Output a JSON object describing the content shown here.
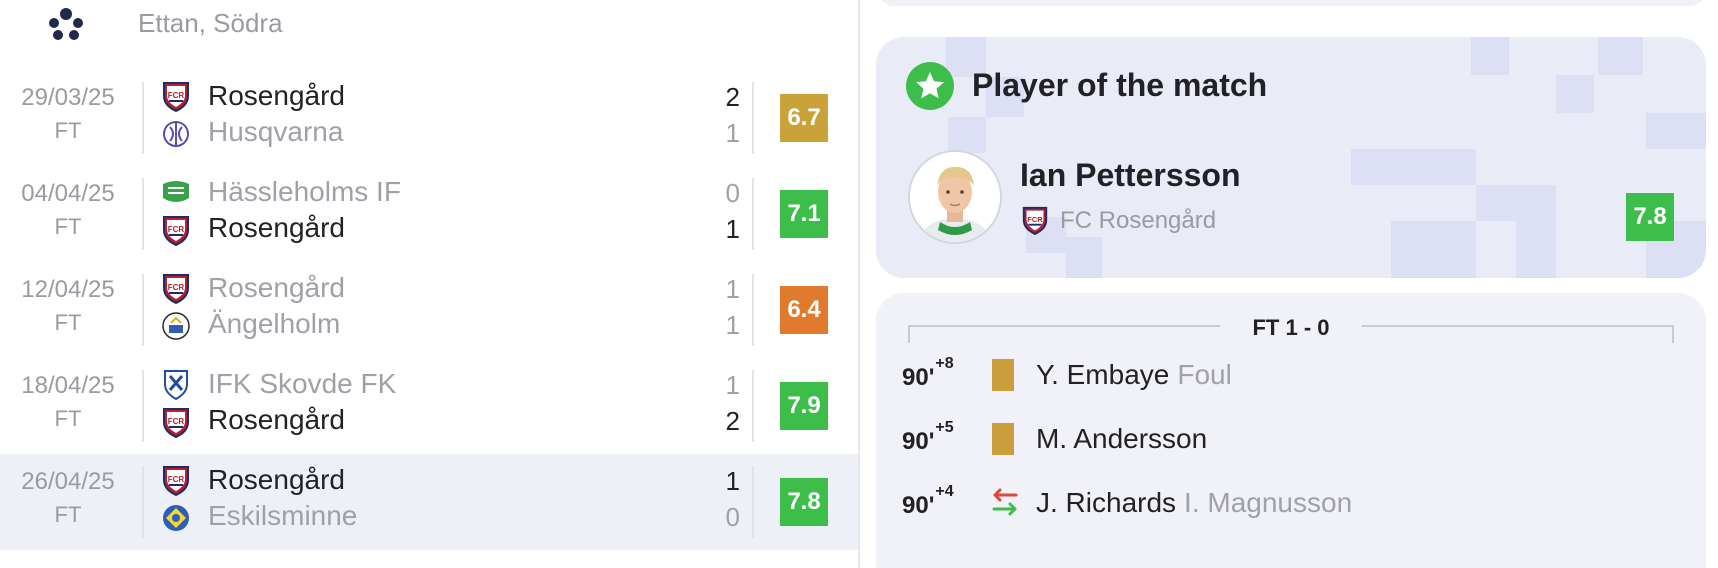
{
  "colors": {
    "rating_yellow": "#c9a33a",
    "rating_green": "#3dbd49",
    "rating_orange": "#e07a2c",
    "yellow_card": "#c99e3b",
    "text_primary": "#222226",
    "text_muted": "#a0a0a8",
    "highlight_row": "#eef0f7"
  },
  "league": {
    "icon": "soccer-ball-icon",
    "name": "Ettan, Södra"
  },
  "matches": [
    {
      "date": "29/03/25",
      "status": "FT",
      "home": {
        "name": "Rosengård",
        "score": "2",
        "crest": "rosengard-crest-icon",
        "winner": true
      },
      "away": {
        "name": "Husqvarna",
        "score": "1",
        "crest": "husqvarna-crest-icon",
        "winner": false
      },
      "rating": "6.7",
      "rating_color": "#c9a33a",
      "highlighted": false
    },
    {
      "date": "04/04/25",
      "status": "FT",
      "home": {
        "name": "Hässleholms IF",
        "score": "0",
        "crest": "hassleholms-crest-icon",
        "winner": false
      },
      "away": {
        "name": "Rosengård",
        "score": "1",
        "crest": "rosengard-crest-icon",
        "winner": true
      },
      "rating": "7.1",
      "rating_color": "#3dbd49",
      "highlighted": false
    },
    {
      "date": "12/04/25",
      "status": "FT",
      "home": {
        "name": "Rosengård",
        "score": "1",
        "crest": "rosengard-crest-icon",
        "winner": false
      },
      "away": {
        "name": "Ängelholm",
        "score": "1",
        "crest": "angelholm-crest-icon",
        "winner": false
      },
      "rating": "6.4",
      "rating_color": "#e07a2c",
      "highlighted": false
    },
    {
      "date": "18/04/25",
      "status": "FT",
      "home": {
        "name": "IFK Skovde FK",
        "score": "1",
        "crest": "ifk-skovde-crest-icon",
        "winner": false
      },
      "away": {
        "name": "Rosengård",
        "score": "2",
        "crest": "rosengard-crest-icon",
        "winner": true
      },
      "rating": "7.9",
      "rating_color": "#3dbd49",
      "highlighted": false
    },
    {
      "date": "26/04/25",
      "status": "FT",
      "home": {
        "name": "Rosengård",
        "score": "1",
        "crest": "rosengard-crest-icon",
        "winner": true
      },
      "away": {
        "name": "Eskilsminne",
        "score": "0",
        "crest": "eskilsminne-crest-icon",
        "winner": false
      },
      "rating": "7.8",
      "rating_color": "#3dbd49",
      "highlighted": true
    }
  ],
  "potm": {
    "icon": "star-icon",
    "title": "Player of the match",
    "player_name": "Ian Pettersson",
    "team": "FC Rosengård",
    "team_crest": "rosengard-crest-icon",
    "rating": "7.8"
  },
  "events": {
    "result_label": "FT 1 - 0",
    "items": [
      {
        "minute": "90'",
        "added": "+8",
        "type": "yellow-card",
        "player": "Y. Embaye",
        "extra": "Foul"
      },
      {
        "minute": "90'",
        "added": "+5",
        "type": "yellow-card",
        "player": "M. Andersson",
        "extra": ""
      },
      {
        "minute": "90'",
        "added": "+4",
        "type": "substitution",
        "player": "J. Richards",
        "extra": "I. Magnusson"
      }
    ]
  }
}
